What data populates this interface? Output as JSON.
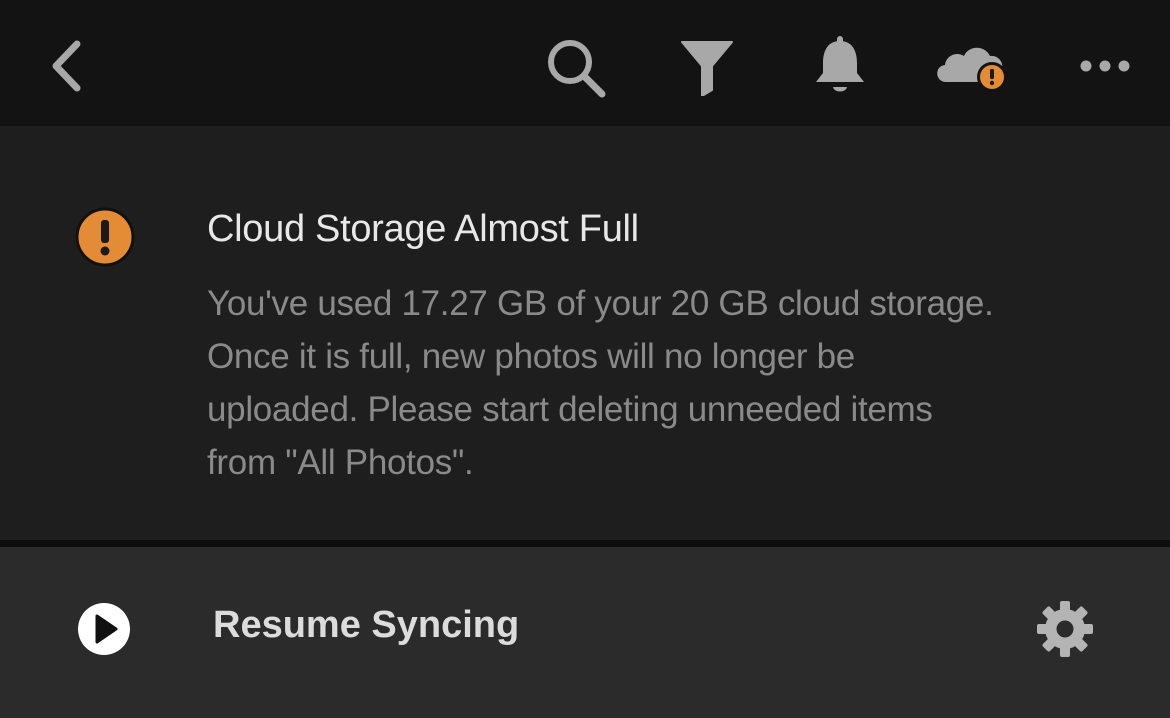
{
  "toolbar": {
    "back_icon": "chevron-left-icon",
    "search_icon": "search-icon",
    "filter_icon": "filter-icon",
    "notifications_icon": "bell-icon",
    "cloud_status_icon": "cloud-warning-icon",
    "more_icon": "more-horizontal-icon"
  },
  "alert": {
    "icon": "warning-circle-icon",
    "title": "Cloud Storage Almost Full",
    "message_lines": [
      "You've used 17.27 GB of your 20 GB cloud storage.",
      "Once it is full, new photos will no longer be",
      "uploaded. Please start deleting unneeded items",
      "from \"All Photos\"."
    ]
  },
  "sync": {
    "play_icon": "play-circle-icon",
    "label": "Resume Syncing",
    "settings_icon": "gear-icon"
  },
  "colors": {
    "warning": "#e38c35",
    "icon_gray": "#a8a8a8",
    "background_top": "#131313",
    "background_alert": "#1e1e1e",
    "background_action": "#2b2b2b"
  }
}
